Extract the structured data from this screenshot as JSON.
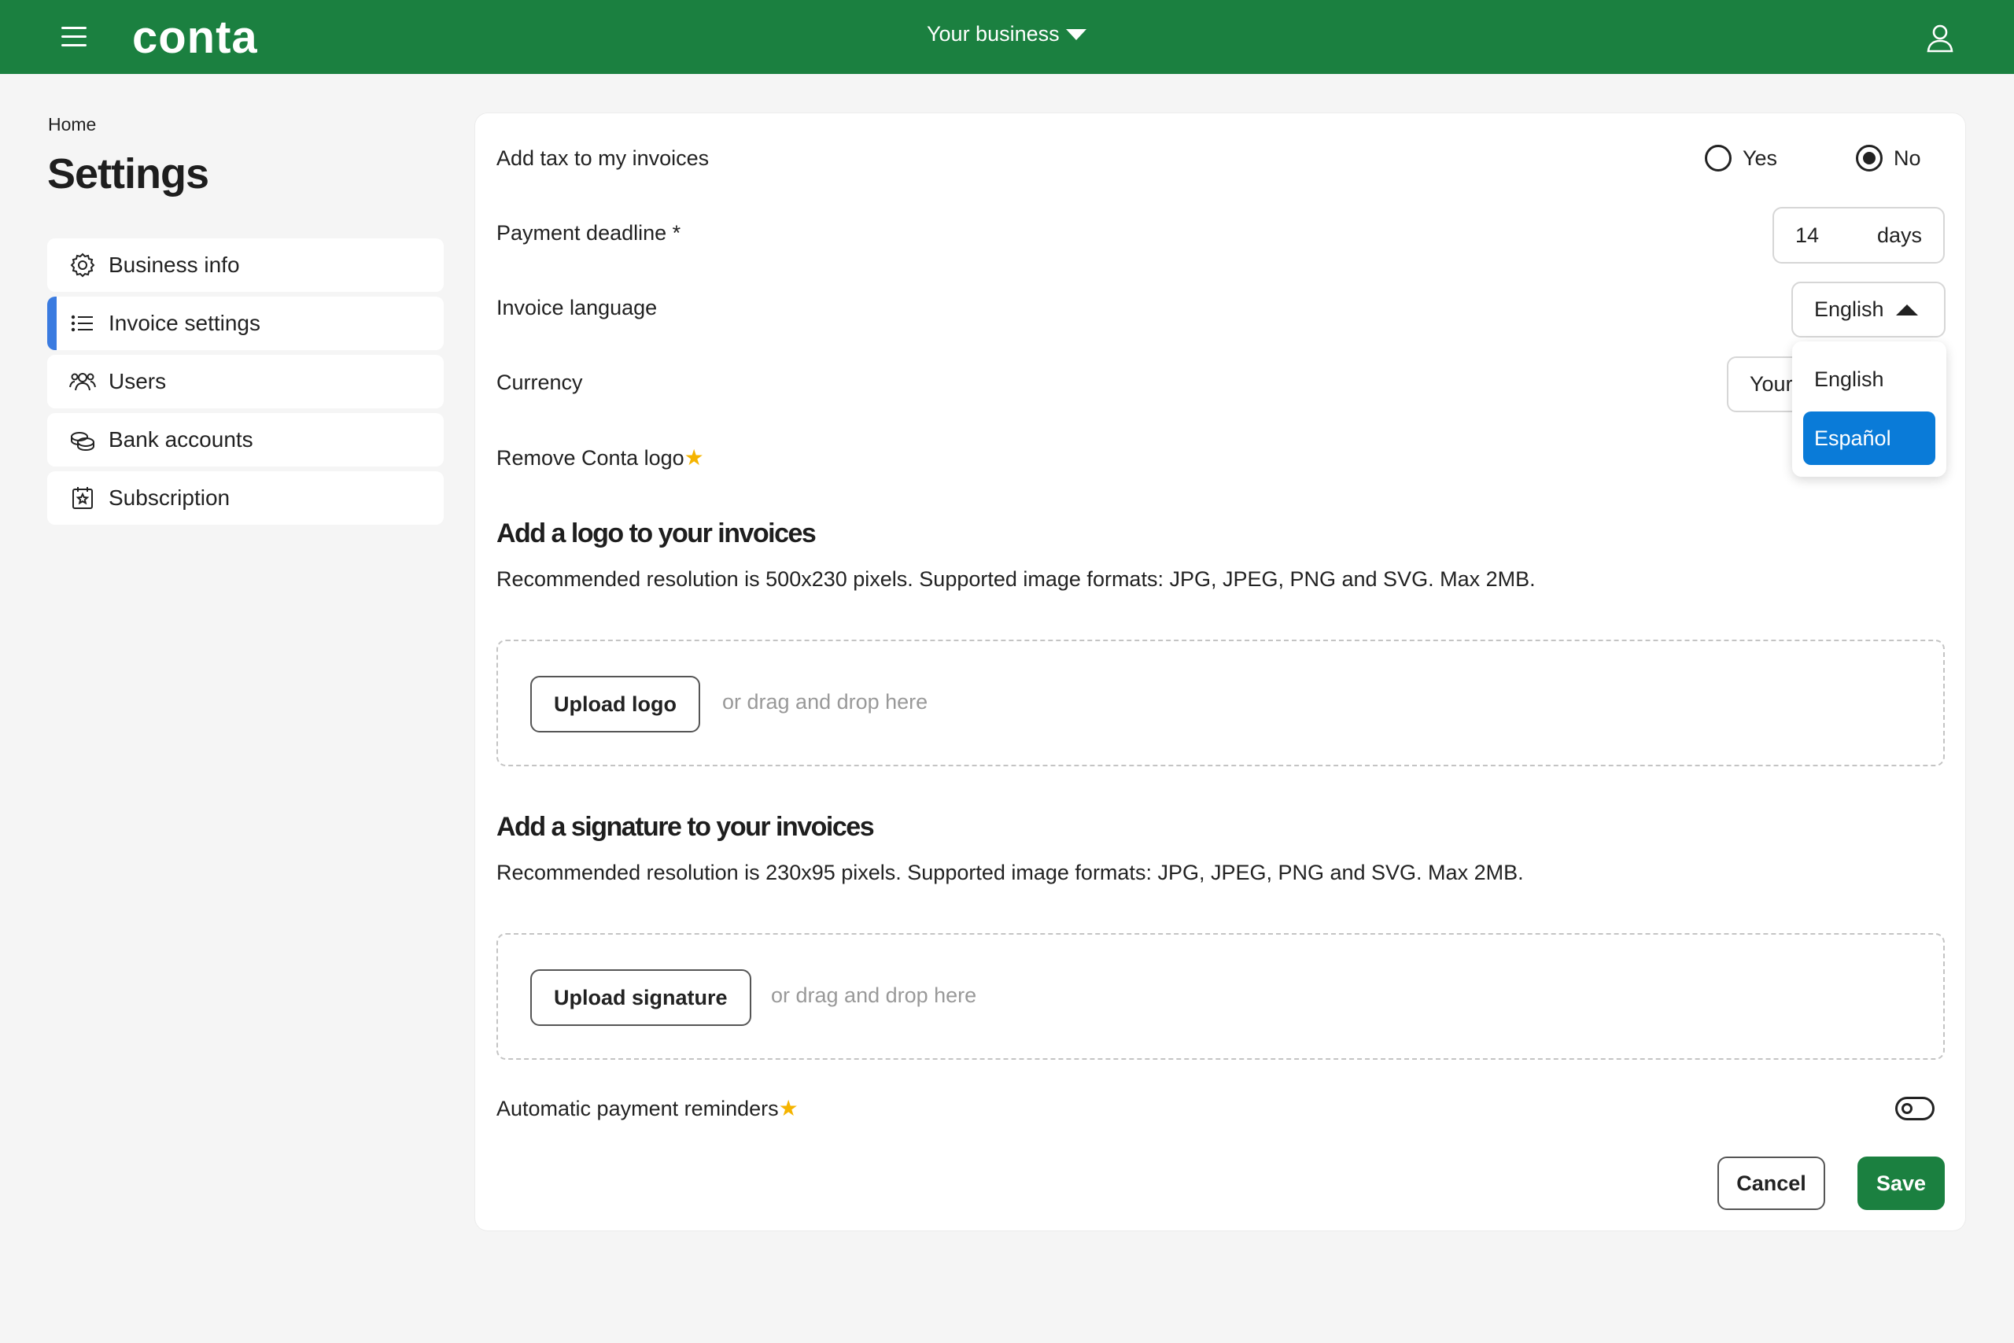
{
  "app": {
    "logo_text": "conta",
    "business_selector": "Your business",
    "brand_color": "#1b8040"
  },
  "breadcrumb": "Home",
  "page_title": "Settings",
  "sidebar": {
    "items": [
      {
        "label": "Business info",
        "icon": "gear-icon"
      },
      {
        "label": "Invoice settings",
        "icon": "list-icon",
        "active": true
      },
      {
        "label": "Users",
        "icon": "users-icon"
      },
      {
        "label": "Bank accounts",
        "icon": "coins-icon"
      },
      {
        "label": "Subscription",
        "icon": "calendar-star-icon"
      }
    ]
  },
  "settings": {
    "tax": {
      "label": "Add tax to my invoices",
      "yes": "Yes",
      "no": "No",
      "selected": "No"
    },
    "payment_deadline": {
      "label": "Payment deadline *",
      "value": "14",
      "unit": "days"
    },
    "invoice_language": {
      "label": "Invoice language",
      "value": "English",
      "options": [
        "English",
        "Español"
      ],
      "highlighted": "Español"
    },
    "currency": {
      "label": "Currency",
      "value": "Your"
    },
    "remove_logo": {
      "label": "Remove Conta logo",
      "premium_star": "★"
    }
  },
  "logo_section": {
    "title": "Add a logo to your invoices",
    "description": "Recommended resolution is 500x230 pixels. Supported image formats: JPG, JPEG, PNG and SVG. Max 2MB.",
    "button": "Upload logo",
    "hint": "or drag and drop here"
  },
  "signature_section": {
    "title": "Add a signature to your invoices",
    "description": "Recommended resolution is 230x95 pixels. Supported image formats: JPG, JPEG, PNG and SVG. Max 2MB.",
    "button": "Upload signature",
    "hint": "or drag and drop here"
  },
  "reminders": {
    "label": "Automatic payment reminders",
    "premium_star": "★",
    "enabled": false
  },
  "actions": {
    "cancel": "Cancel",
    "save": "Save"
  }
}
